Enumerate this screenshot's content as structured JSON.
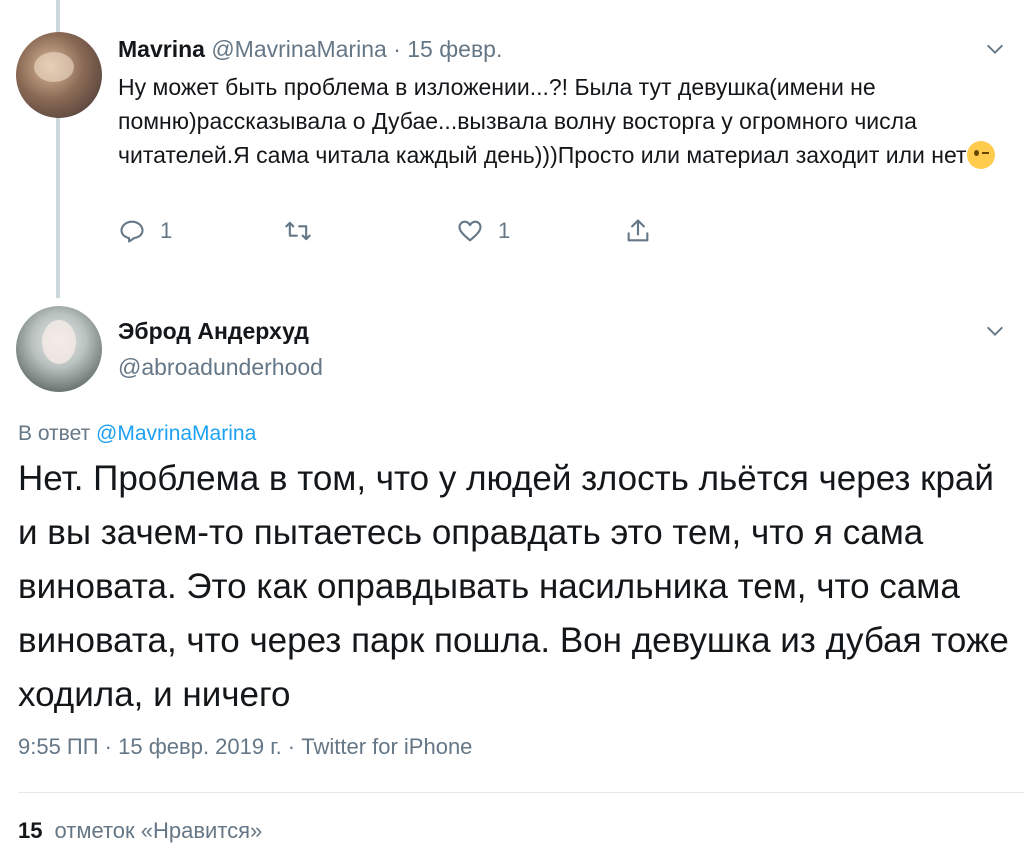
{
  "parent_tweet": {
    "name": "Mavrina",
    "handle": "@MavrinaMarina",
    "separator": "·",
    "date": "15 февр.",
    "text": "Ну может быть проблема в изложении...?! Была тут девушка(имени не помню)рассказывала о Дубае...вызвала волну восторга у огромного числа читателей.Я сама читала каждый день)))Просто или материал заходит или нет",
    "emoji": "winking-face-emoji",
    "reply_count": "1",
    "retweet_count": "",
    "like_count": "1"
  },
  "main_tweet": {
    "name": "Эброд Андерхуд",
    "handle": "@abroadunderhood",
    "reply_prefix": "В ответ",
    "reply_to": "@MavrinaMarina",
    "text": "Нет. Проблема в том, что у людей злость льётся через край и вы зачем-то пытаетесь оправдать это тем, что я сама виновата. Это как оправдывать насильника тем, что сама виновата, что через парк пошла. Вон девушка из дубая тоже ходила, и ничего",
    "meta": "9:55 ПП · 15 февр. 2019 г. · Twitter for iPhone",
    "likes_count": "15",
    "likes_label": "отметок «Нравится»"
  },
  "colors": {
    "text": "#14171a",
    "muted": "#657786",
    "link": "#1da1f2",
    "thread_line": "#ccd6dd",
    "divider": "#e1e8ed"
  },
  "icons": [
    "chevron-down-icon",
    "reply-icon",
    "retweet-icon",
    "like-icon",
    "share-icon"
  ]
}
